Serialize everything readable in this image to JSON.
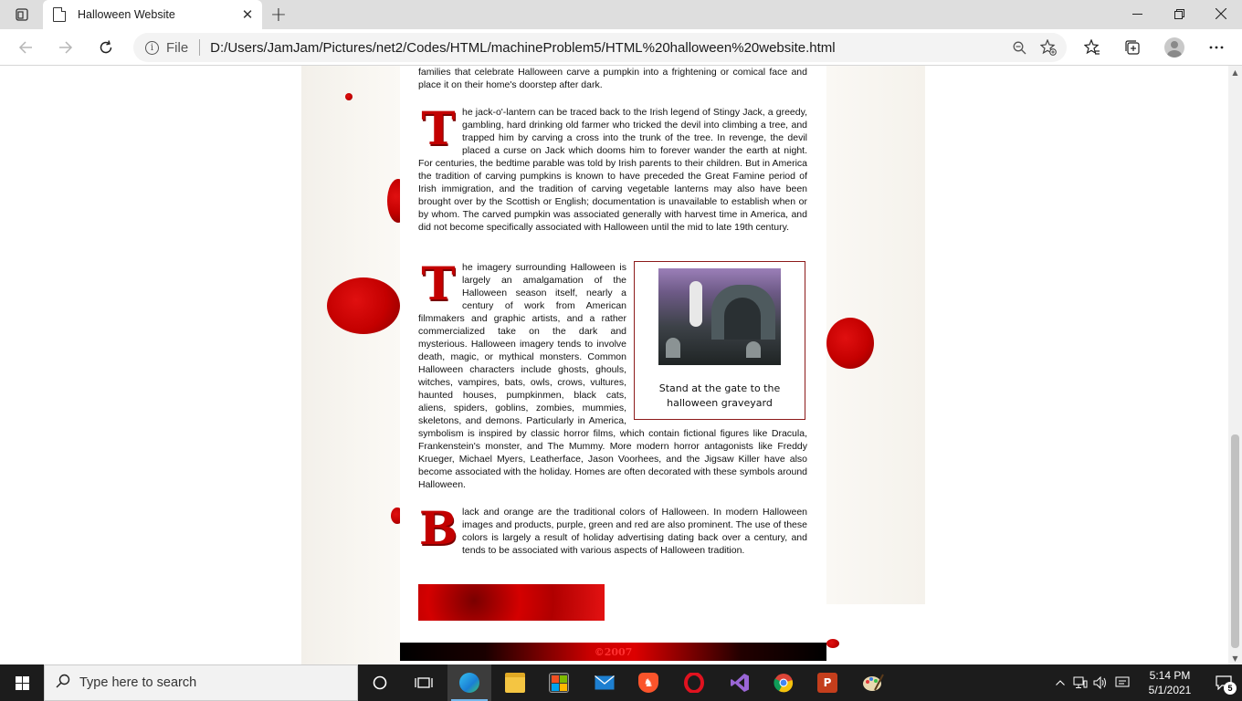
{
  "browser": {
    "tab_title": "Halloween Website",
    "url_scheme": "File",
    "url": "D:/Users/JamJam/Pictures/net2/Codes/HTML/machineProblem5/HTML%20halloween%20website.html"
  },
  "page": {
    "intro_tail": "families that celebrate Halloween carve a pumpkin into a frightening or comical face and place it on their home's doorstep after dark.",
    "p1_dropcap": "T",
    "p1_text": "he jack-o'-lantern can be traced back to the Irish legend of Stingy Jack, a greedy, gambling, hard drinking old farmer who tricked the devil into climbing a tree, and trapped him by carving a cross into the trunk of the tree. In revenge, the devil placed a curse on Jack which dooms him to forever wander the earth at night. For centuries, the bedtime parable was told by Irish parents to their children. But in America the tradition of carving pumpkins is known to have preceded the Great Famine period of Irish immigration, and the tradition of carving vegetable lanterns may also have been brought over by the Scottish or English; documentation is unavailable to establish when or by whom. The carved pumpkin was associated generally with harvest time in America, and did not become specifically associated with Halloween until the mid to late 19th century.",
    "p2_dropcap": "T",
    "p2_text": "he imagery surrounding Halloween is largely an amalgamation of the Halloween season itself, nearly a century of work from American filmmakers and graphic artists, and a rather commercialized take on the dark and mysterious. Halloween imagery tends to involve death, magic, or mythical monsters. Common Halloween characters include ghosts, ghouls, witches, vampires, bats, owls, crows, vultures, haunted houses, pumpkinmen, black cats, aliens, spiders, goblins, zombies, mummies, skeletons, and demons. Particularly in America, symbolism is inspired by classic horror films, which contain fictional figures like Dracula, Frankenstein's monster, and The Mummy. More modern horror antagonists like Freddy Krueger, Michael Myers, Leatherface, Jason Voorhees, and the Jigsaw Killer have also become associated with the holiday. Homes are often decorated with these symbols around Halloween.",
    "figure_caption": "Stand at the gate to the halloween graveyard",
    "p3_dropcap": "B",
    "p3_text": "lack and orange are the traditional colors of Halloween. In modern Halloween images and products, purple, green and red are also prominent. The use of these colors is largely a result of holiday advertising dating back over a century, and tends to be associated with various aspects of Halloween tradition.",
    "footer": "©2007",
    "accent_color": "#c30000"
  },
  "taskbar": {
    "search_placeholder": "Type here to search",
    "time": "5:14 PM",
    "date": "5/1/2021",
    "notification_count": "5"
  }
}
